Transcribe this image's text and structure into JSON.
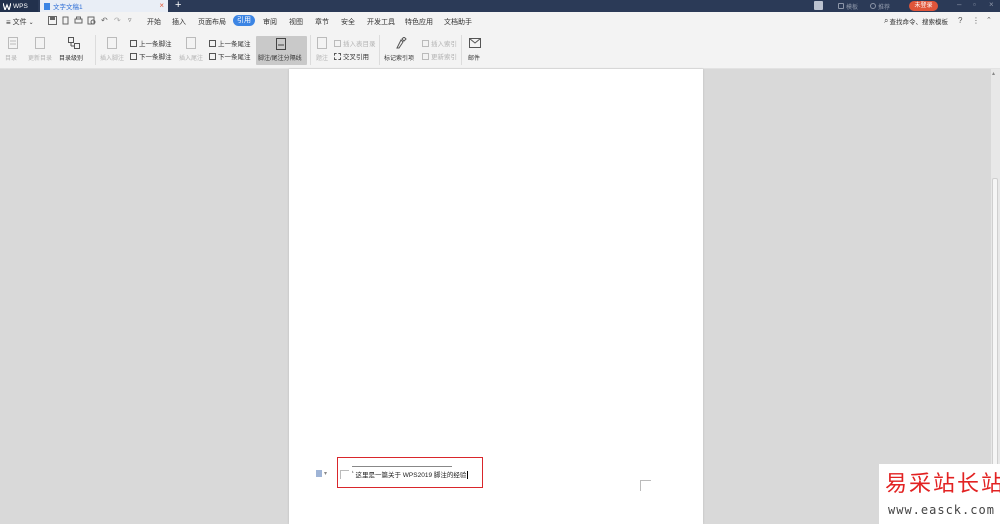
{
  "titlebar": {
    "wps_label": "WPS",
    "doc_tab_label": "文字文稿1",
    "add_tab": "+",
    "template_label": "模板",
    "collab_label": "推荐",
    "login_label": "未登录"
  },
  "menubar": {
    "file_label": "文件",
    "tabs": [
      "开始",
      "插入",
      "页面布局",
      "引用",
      "审阅",
      "视图",
      "章节",
      "安全",
      "开发工具",
      "特色应用",
      "文档助手"
    ],
    "active_tab": "引用",
    "search_label": "查找命令、搜索模板"
  },
  "ribbon": {
    "toc_label": "目录",
    "update_toc_label": "更新目录",
    "toc_level_label": "目录级别",
    "insert_footnote_label": "插入脚注",
    "prev_footnote_label": "上一条脚注",
    "next_footnote_label": "下一条脚注",
    "insert_endnote_label": "插入尾注",
    "prev_endnote_label": "上一条尾注",
    "next_endnote_label": "下一条尾注",
    "separator_line_label": "脚注/尾注分隔线",
    "caption_label": "题注",
    "insert_table_caption_label": "插入表目录",
    "cross_ref_label": "交叉引用",
    "mark_index_label": "标记索引项",
    "insert_index_label": "插入索引",
    "update_index_label": "更新索引",
    "mail_label": "邮件"
  },
  "document": {
    "footnote_marker": "¹",
    "footnote_text": "这里是一篇关于 WPS2019 脚注的经验"
  },
  "watermark": {
    "title": "易采站长站",
    "url": "www.easck.com"
  },
  "colors": {
    "accent": "#3c85e4",
    "login": "#e0553a",
    "highlight_box": "#d9262b",
    "titlebar": "#2b3a57"
  }
}
